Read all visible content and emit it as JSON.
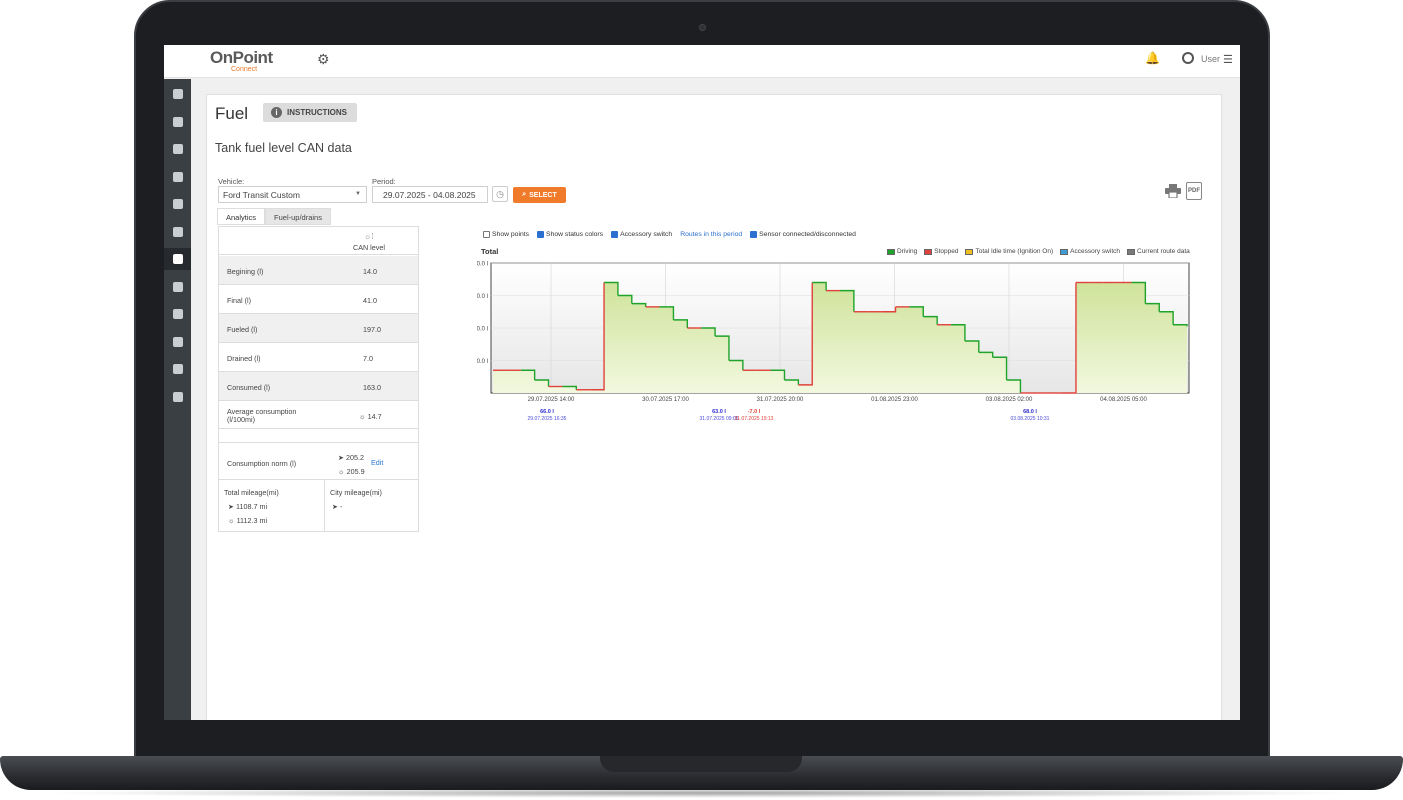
{
  "app": {
    "logo_main": "OnPoint",
    "logo_sub": "Connect",
    "user_label": "User"
  },
  "colors": {
    "accent": "#f07b2a",
    "sidebar": "#3a3f44",
    "link": "#2b6fd0",
    "driving": "#1fa32b",
    "stopped": "#e0413a",
    "idle": "#f0c020",
    "accessory": "#3e9bd6",
    "route": "#7a7a7a"
  },
  "sidebar": {
    "items": [
      "map-icon",
      "document-icon",
      "car-icon",
      "driver-icon",
      "dashboard-icon",
      "video-icon",
      "fuel-icon",
      "alert-icon",
      "tasks-icon",
      "messages-icon",
      "settings-icon",
      "plugins-icon"
    ],
    "active_index": 6
  },
  "page": {
    "title": "Fuel",
    "instructions_label": "INSTRUCTIONS",
    "subtitle": "Tank fuel level CAN data"
  },
  "filters": {
    "vehicle_label": "Vehicle:",
    "vehicle_value": "Ford Transit Custom",
    "period_label": "Period:",
    "period_value": "29.07.2025 - 04.08.2025",
    "select_label": "SELECT"
  },
  "tabs": [
    {
      "label": "Analytics",
      "active": true
    },
    {
      "label": "Fuel-up/drains",
      "active": false
    }
  ],
  "stats": {
    "column": "CAN level",
    "rows": [
      {
        "label": "Begining (l)",
        "value": "14.0"
      },
      {
        "label": "Final (l)",
        "value": "41.0"
      },
      {
        "label": "Fueled (l)",
        "value": "197.0"
      },
      {
        "label": "Drained (l)",
        "value": "7.0"
      },
      {
        "label": "Consumed (l)",
        "value": "163.0"
      }
    ],
    "avg_label": "Average consumption (l/100mi)",
    "avg_value": "14.7",
    "norm_label": "Consumption norm (l)",
    "norm_value_1": "205.2",
    "norm_value_2": "205.9",
    "edit_label": "Edit",
    "total_mileage_label": "Total mileage(mi)",
    "total_mileage_1": "1108.7 mi",
    "total_mileage_2": "1112.3 mi",
    "city_mileage_label": "City mileage(mi)",
    "city_mileage_value": "-"
  },
  "options": {
    "show_points": "Show points",
    "show_status_colors": "Show status colors",
    "accessory_switch": "Accessory switch",
    "routes_link": "Routes in this period",
    "sensor": "Sensor connected/disconnected"
  },
  "legend": [
    "Driving",
    "Stopped",
    "Total Idle time (Ignition On)",
    "Accessory switch",
    "Current route data"
  ],
  "chart_data": {
    "type": "area",
    "title": "Total",
    "ylim": [
      0,
      80
    ],
    "yticks": [
      "80.0 l",
      "60.0 l",
      "40.0 l",
      "20.0 l"
    ],
    "xticks": [
      "29.07.2025 14:00",
      "30.07.2025 17:00",
      "31.07.2025 20:00",
      "01.08.2025 23:00",
      "03.08.2025 02:00",
      "04.08.2025 05:00"
    ],
    "grid": true,
    "series": [
      {
        "values": [
          14,
          14,
          14,
          8,
          4,
          4,
          2,
          2,
          68,
          60,
          55,
          53,
          53,
          45,
          40,
          40,
          35,
          20,
          14,
          14,
          14,
          8,
          5,
          68,
          63,
          63,
          50,
          50,
          50,
          53,
          53,
          47,
          42,
          42,
          32,
          25,
          22,
          8,
          0,
          0,
          0,
          0,
          68,
          68,
          68,
          68,
          68,
          55,
          50,
          42,
          41
        ]
      }
    ],
    "events": [
      {
        "value": "66.0 l",
        "time": "29.07.2025 16:35"
      },
      {
        "value": "63.0 l",
        "time": "31.07.2025 09:05"
      },
      {
        "value": "-7.0 l",
        "time": "31.07.2025 19:13"
      },
      {
        "value": "68.0 l",
        "time": "03.08.2025 10:31"
      }
    ]
  }
}
